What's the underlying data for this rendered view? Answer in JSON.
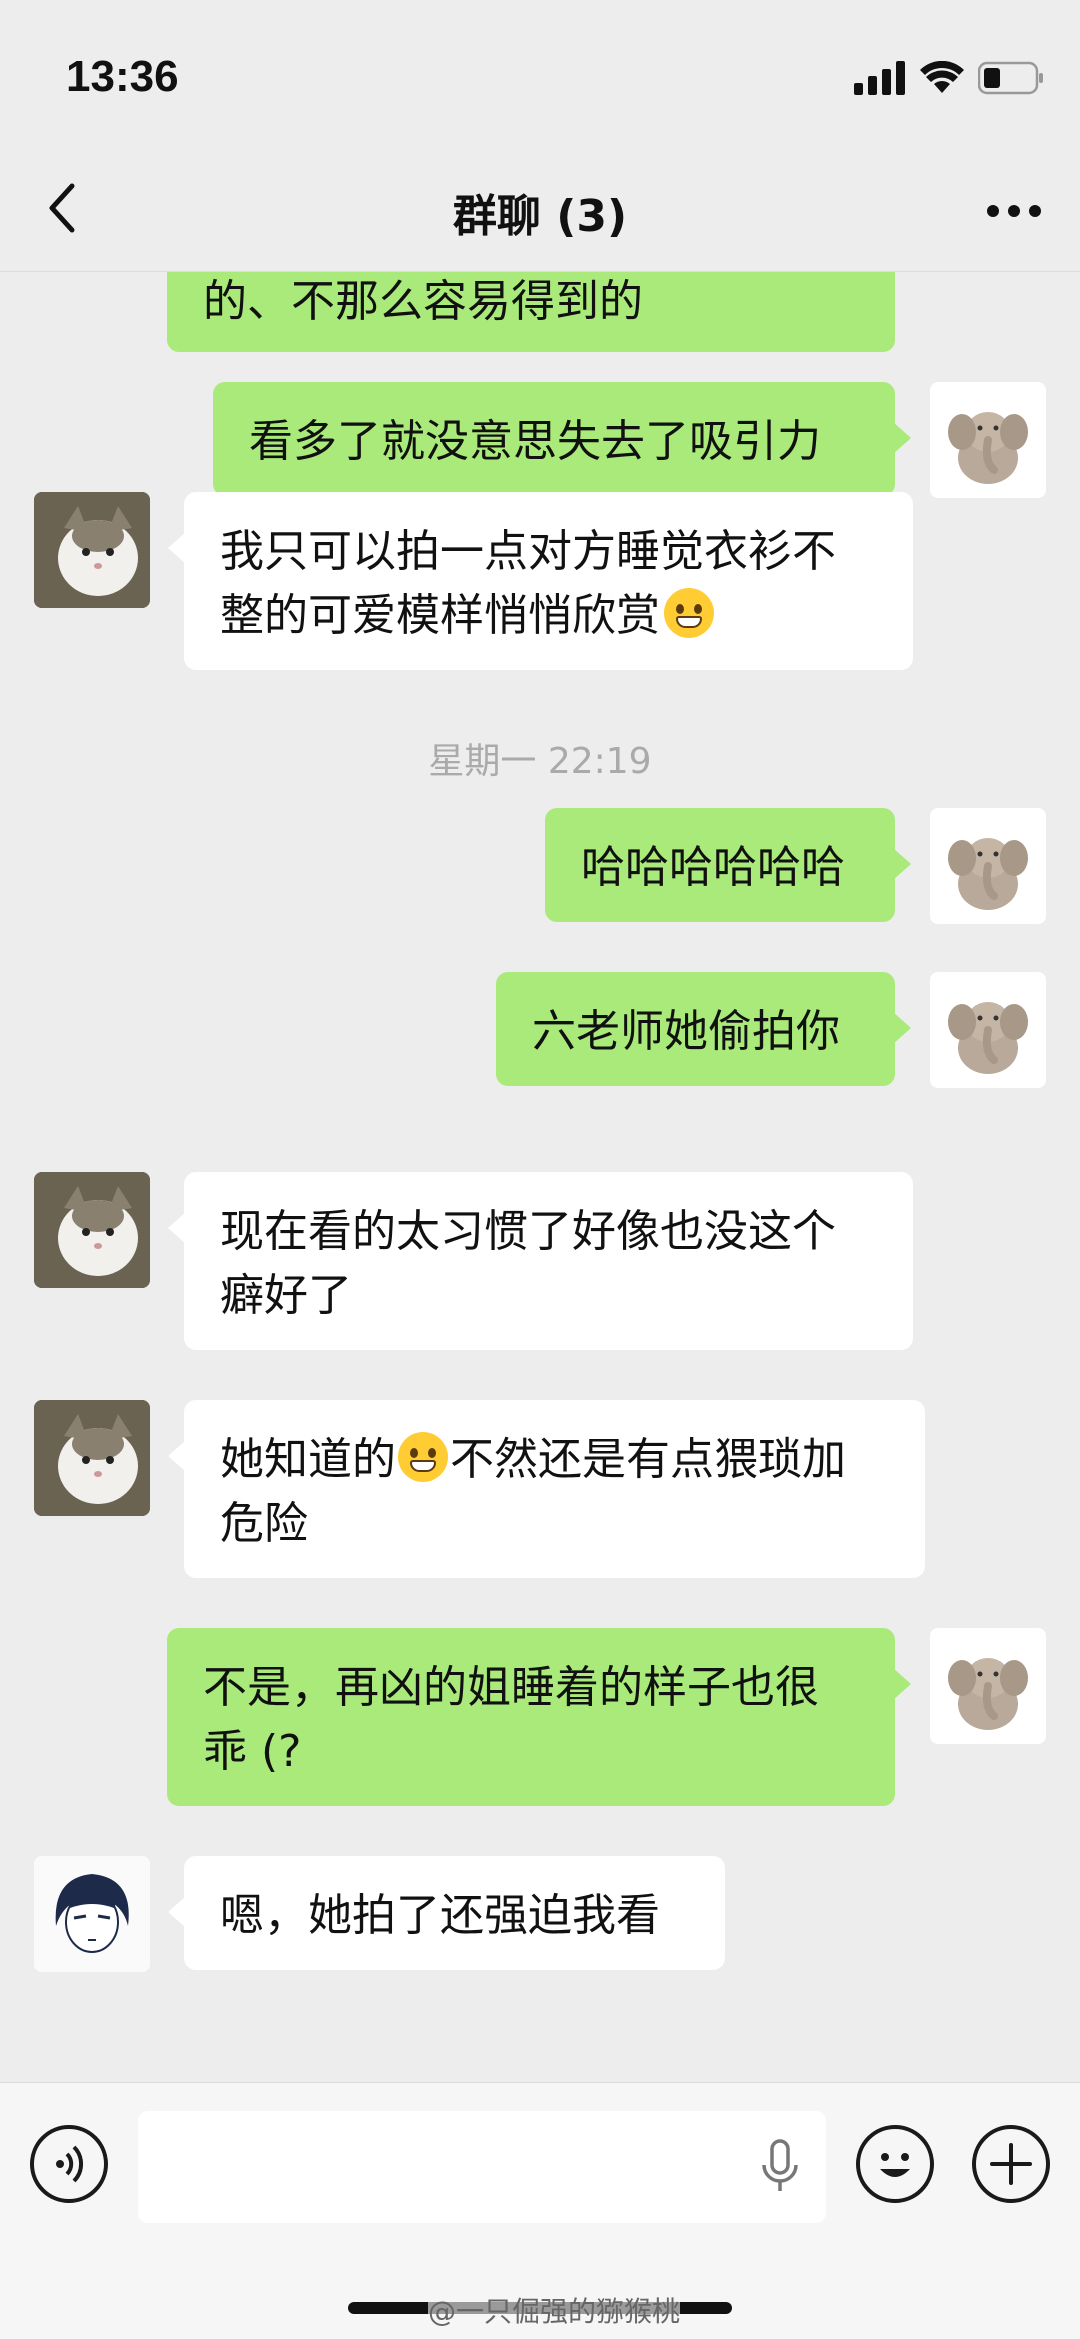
{
  "status_bar": {
    "time": "13:36"
  },
  "header": {
    "title": "群聊 (3)"
  },
  "messages": [
    {
      "side": "me",
      "text": "的、不那么容易得到的"
    },
    {
      "side": "me",
      "text": "看多了就没意思失去了吸引力"
    },
    {
      "side": "them",
      "avatar": "cat-avatar",
      "text_line1": "我只可以拍一点对方睡觉衣衫不",
      "text_line2": "整的可爱模样悄悄欣赏",
      "emoji": "laughing-crying-emoji"
    },
    {
      "type": "timestamp",
      "text": "星期一 22:19"
    },
    {
      "side": "me",
      "text": "哈哈哈哈哈哈"
    },
    {
      "side": "me",
      "text": "六老师她偷拍你"
    },
    {
      "side": "them",
      "avatar": "cat-avatar",
      "text_line1": "现在看的太习惯了好像也没这个",
      "text_line2": "癖好了"
    },
    {
      "side": "them",
      "avatar": "cat-avatar",
      "text_line1_a": "她知道的",
      "emoji": "grimacing-emoji",
      "text_line1_b": "不然还是有点猥琐加",
      "text_line2": "危险"
    },
    {
      "side": "me",
      "text_line1": "不是，再凶的姐睡着的样子也很",
      "text_line2": "乖 (?"
    },
    {
      "side": "them",
      "avatar": "anime-avatar",
      "text": "嗯，她拍了还强迫我看"
    }
  ],
  "watermark": "@一只倔强的猕猴桃",
  "icons": [
    "back-icon",
    "more-icon",
    "voice-icon",
    "microphone-icon",
    "emoji-icon",
    "plus-icon",
    "elephant-avatar",
    "cat-avatar",
    "anime-avatar"
  ],
  "colors": {
    "background": "#ededed",
    "my_bubble": "#a9ea7a",
    "their_bubble": "#ffffff"
  }
}
